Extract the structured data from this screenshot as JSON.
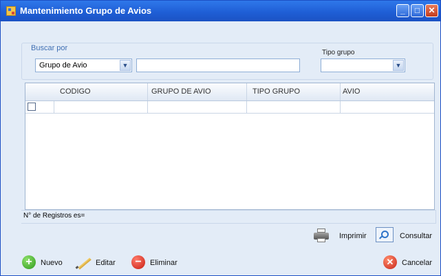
{
  "window": {
    "title": "Mantenimiento Grupo de Avios",
    "buttons": {
      "minimize": "_",
      "maximize": "□",
      "close": "✕"
    }
  },
  "search": {
    "legend": "Buscar por",
    "field_selected": "Grupo de Avio",
    "text_value": "",
    "tipo_label": "Tipo grupo",
    "tipo_selected": ""
  },
  "grid": {
    "columns": [
      "CODIGO",
      "GRUPO DE AVIO",
      "TIPO GRUPO",
      "AVIO"
    ],
    "rows": [
      {
        "checked": false,
        "codigo": "",
        "grupo": "",
        "tipo": "",
        "avio": ""
      }
    ]
  },
  "status": {
    "text": "N° de Registros es="
  },
  "toolbar": {
    "print_label": "Imprimir",
    "consult_label": "Consultar"
  },
  "actions": {
    "new_label": "Nuevo",
    "edit_label": "Editar",
    "delete_label": "Eliminar",
    "cancel_label": "Cancelar"
  },
  "icons": [
    "app-icon",
    "chevron-down-icon",
    "printer-icon",
    "search-icon",
    "plus-icon",
    "pencil-icon",
    "minus-icon",
    "close-icon"
  ],
  "colors": {
    "titlebar": "#1f5fd6",
    "window_bg": "#e3ecf7",
    "legend_text": "#3f6fb3"
  }
}
